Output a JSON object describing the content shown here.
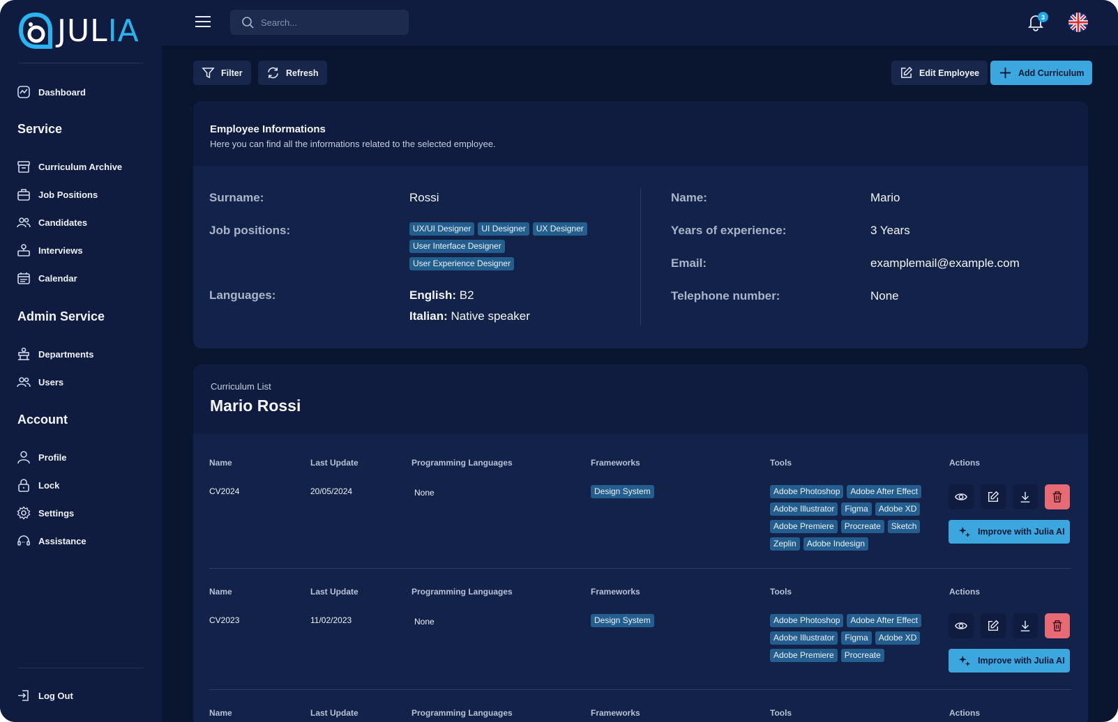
{
  "app": {
    "logo_text_white": "JUL",
    "logo_text_accent": "IA"
  },
  "sidebar": {
    "dashboard": "Dashboard",
    "sections": {
      "service": "Service",
      "admin": "Admin Service",
      "account": "Account"
    },
    "service_items": [
      "Curriculum Archive",
      "Job Positions",
      "Candidates",
      "Interviews",
      "Calendar"
    ],
    "admin_items": [
      "Departments",
      "Users"
    ],
    "account_items": [
      "Profile",
      "Lock",
      "Settings",
      "Assistance"
    ],
    "logout": "Log Out"
  },
  "topbar": {
    "search_placeholder": "Search...",
    "notifications_count": "3",
    "language_flag": "uk-flag-icon"
  },
  "toolbar": {
    "filter": "Filter",
    "refresh": "Refresh",
    "edit_employee": "Edit Employee",
    "add_curriculum": "Add Curriculum"
  },
  "employee": {
    "title": "Employee Informations",
    "subtitle": "Here you can find all the informations related to the selected employee.",
    "labels": {
      "surname": "Surname:",
      "job_positions": "Job positions:",
      "languages": "Languages:",
      "name": "Name:",
      "years": "Years of experience:",
      "email": "Email:",
      "phone": "Telephone number:"
    },
    "surname": "Rossi",
    "name": "Mario",
    "years": "3 Years",
    "email": "examplemail@example.com",
    "phone": "None",
    "job_positions": [
      "UX/UI Designer",
      "UI Designer",
      "UX Designer",
      "User Interface Designer",
      "User Experience Designer"
    ],
    "languages": [
      {
        "lang": "English:",
        "level": "B2"
      },
      {
        "lang": "Italian:",
        "level": "Native speaker"
      }
    ]
  },
  "curriculum": {
    "kicker": "Curriculum List",
    "owner": "Mario Rossi",
    "columns": {
      "name": "Name",
      "last_update": "Last Update",
      "prog": "Programming Languages",
      "frameworks": "Frameworks",
      "tools": "Tools",
      "actions": "Actions"
    },
    "improve_label": "Improve with Julia AI",
    "rows": [
      {
        "name": "CV2024",
        "last_update": "20/05/2024",
        "prog": "None",
        "frameworks": [
          "Design System"
        ],
        "tools": [
          "Adobe Photoshop",
          "Adobe After Effect",
          "Adobe Illustrator",
          "Figma",
          "Adobe XD",
          "Adobe Premiere",
          "Procreate",
          "Sketch",
          "Zeplin",
          "Adobe Indesign"
        ]
      },
      {
        "name": "CV2023",
        "last_update": "11/02/2023",
        "prog": "None",
        "frameworks": [
          "Design System"
        ],
        "tools": [
          "Adobe Photoshop",
          "Adobe After Effect",
          "Adobe Illustrator",
          "Figma",
          "Adobe XD",
          "Adobe Premiere",
          "Procreate"
        ]
      }
    ]
  }
}
